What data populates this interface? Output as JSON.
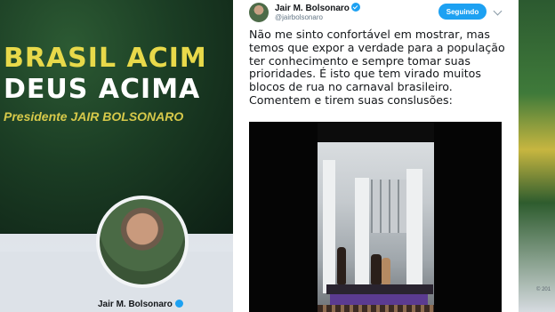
{
  "profile_page": {
    "banner_line1": "BRASIL ACIM",
    "banner_line2": "DEUS ACIMA",
    "banner_sub": "Presidente JAIR BOLSONARO",
    "name": "Jair M. Bolsonaro"
  },
  "tweet": {
    "author_name": "Jair M. Bolsonaro",
    "handle": "@jairbolsonaro",
    "follow_label": "Seguindo",
    "text_lines": [
      "Não me sinto confortável em mostrar, mas",
      "temos que expor a verdade para a população",
      "ter conhecimento e sempre tomar suas",
      "prioridades. É isto que tem virado muitos",
      "blocos de rua no carnaval brasileiro.",
      "Comentem e tirem suas conslusões:"
    ]
  },
  "right_edge": {
    "copyright": "© 201"
  },
  "icons": [
    "verified-badge-icon",
    "chevron-down-icon"
  ],
  "colors": {
    "accent": "#1da1f2",
    "banner_yellow": "#e8d94a"
  }
}
